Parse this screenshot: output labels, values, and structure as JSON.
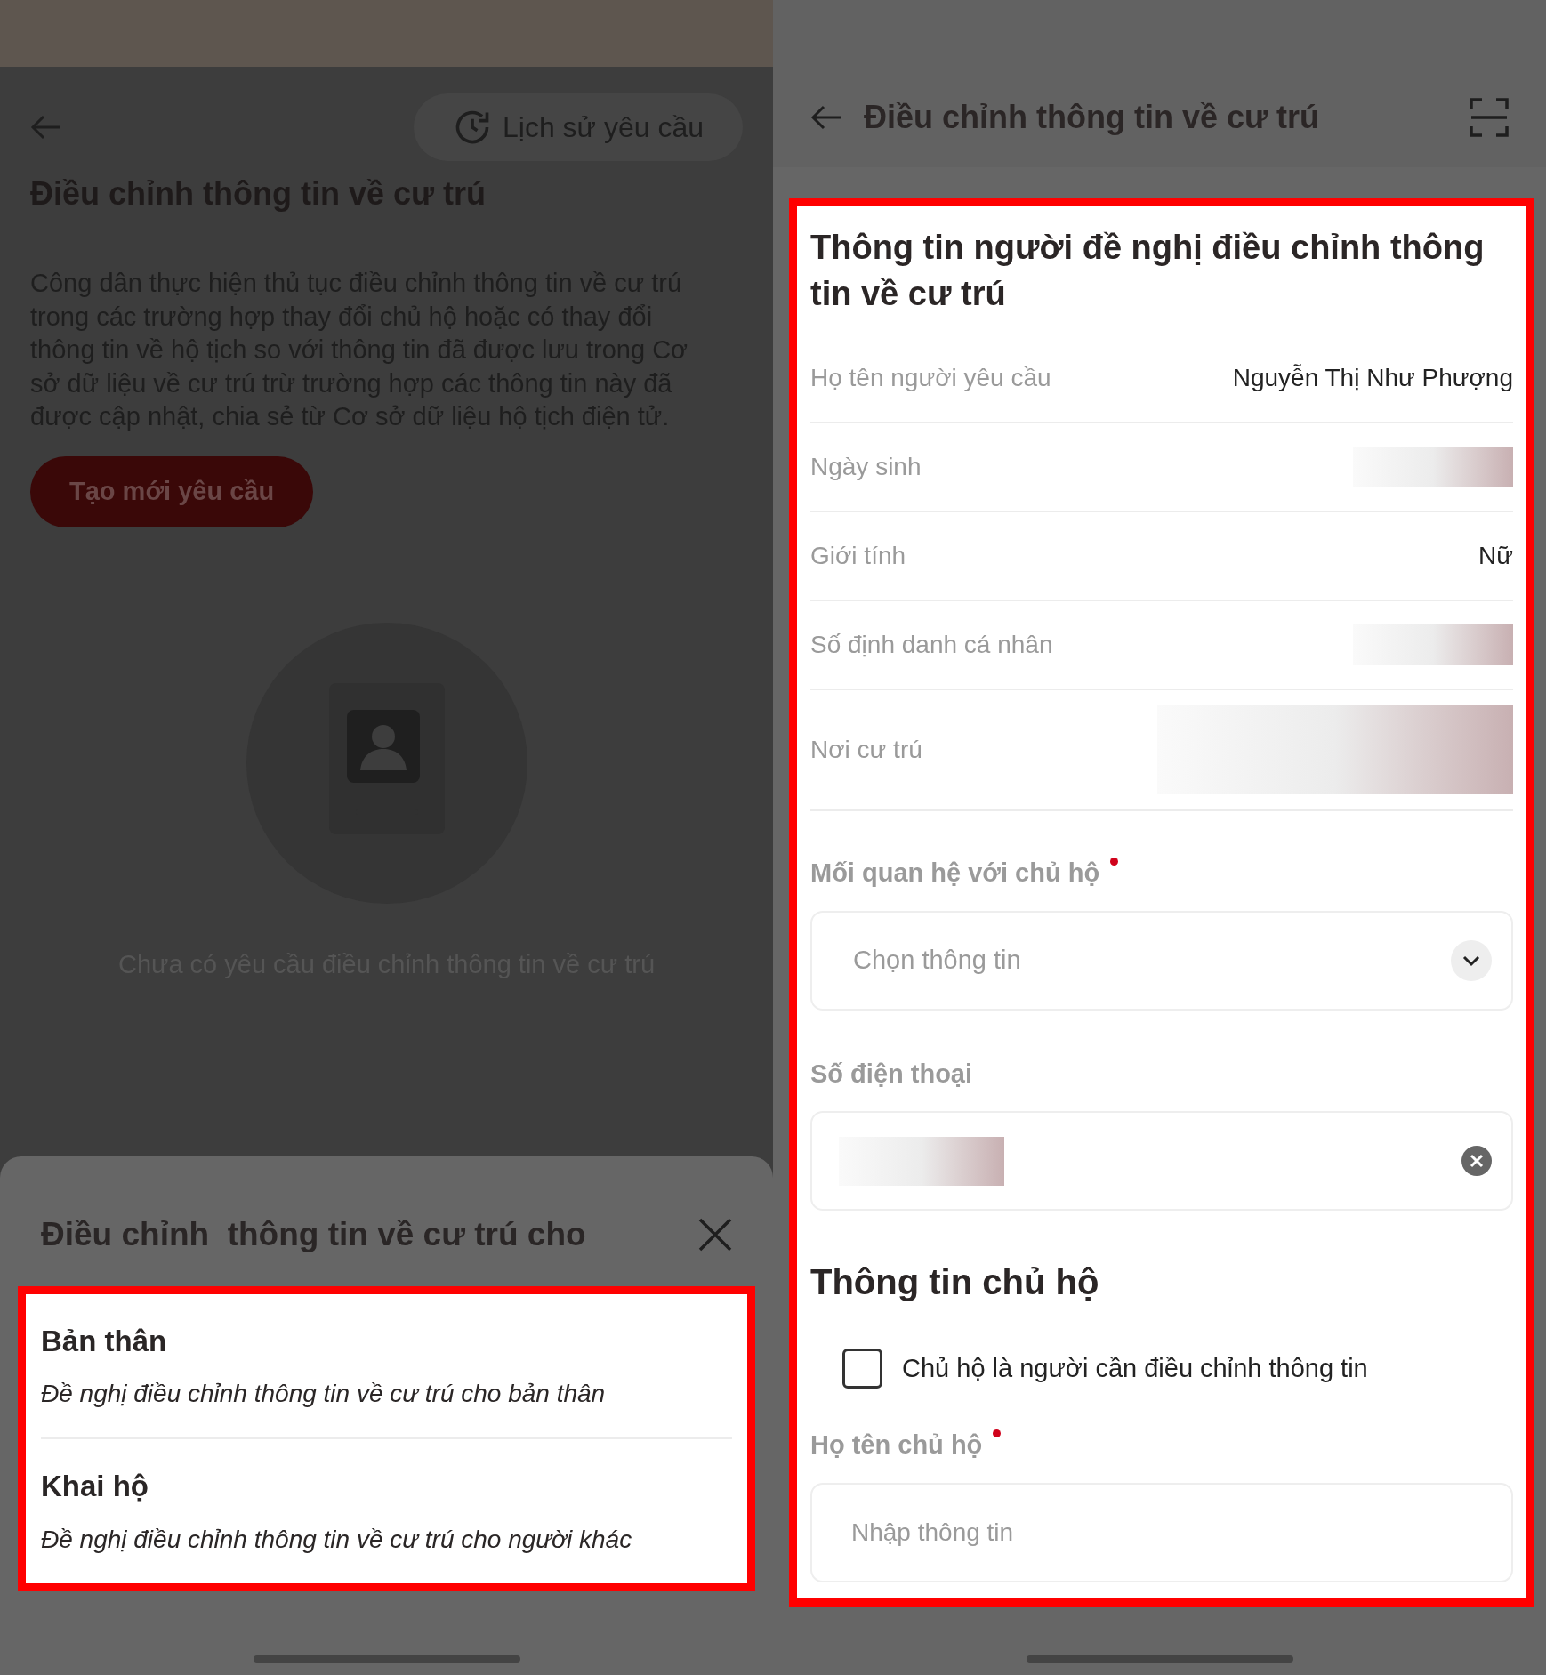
{
  "left_screen": {
    "history_button": "Lịch sử yêu cầu",
    "title": "Điều chỉnh thông tin về cư trú",
    "description": "Công dân thực hiện thủ tục điều chỉnh thông tin về cư trú trong các trường hợp thay đổi chủ hộ hoặc có thay đổi thông tin về hộ tịch so với thông tin đã được lưu trong Cơ sở dữ liệu về cư trú trừ trường hợp các thông tin này đã được cập nhật, chia sẻ từ Cơ sở dữ liệu hộ tịch điện tử.",
    "create_button": "Tạo mới yêu cầu",
    "empty_message": "Chưa có yêu cầu điều chỉnh thông tin về cư trú",
    "sheet": {
      "title": "Điều chỉnh  thông tin về cư trú cho",
      "options": [
        {
          "title": "Bản thân",
          "subtitle": "Đề nghị điều chỉnh thông tin về cư trú cho bản thân"
        },
        {
          "title": "Khai hộ",
          "subtitle": "Đề nghị điều chỉnh thông tin về cư trú cho người khác"
        }
      ]
    }
  },
  "right_screen": {
    "title": "Điều chỉnh thông tin về cư trú",
    "section_title": "Thông tin người đề nghị điều chỉnh thông tin về cư trú",
    "info_rows": [
      {
        "kind": "text",
        "label": "Họ tên người yêu cầu",
        "value": "Nguyễn Thị Như Phượng"
      },
      {
        "kind": "redacted",
        "label": "Ngày sinh"
      },
      {
        "kind": "text",
        "label": "Giới tính",
        "value": "Nữ"
      },
      {
        "kind": "redacted",
        "label": "Số định danh cá nhân"
      },
      {
        "kind": "redacted_tall",
        "label": "Nơi cư trú"
      }
    ],
    "relationship": {
      "label": "Mối quan hệ với chủ hộ",
      "required": true,
      "placeholder": "Chọn thông tin"
    },
    "phone": {
      "label": "Số điện thoại"
    },
    "owner_section_title": "Thông tin chủ hộ",
    "owner_checkbox": {
      "label": "Chủ hộ là người cần điều chỉnh thông tin",
      "checked": false
    },
    "owner_name": {
      "label": "Họ tên chủ hộ",
      "required": true,
      "placeholder": "Nhập thông tin"
    }
  }
}
